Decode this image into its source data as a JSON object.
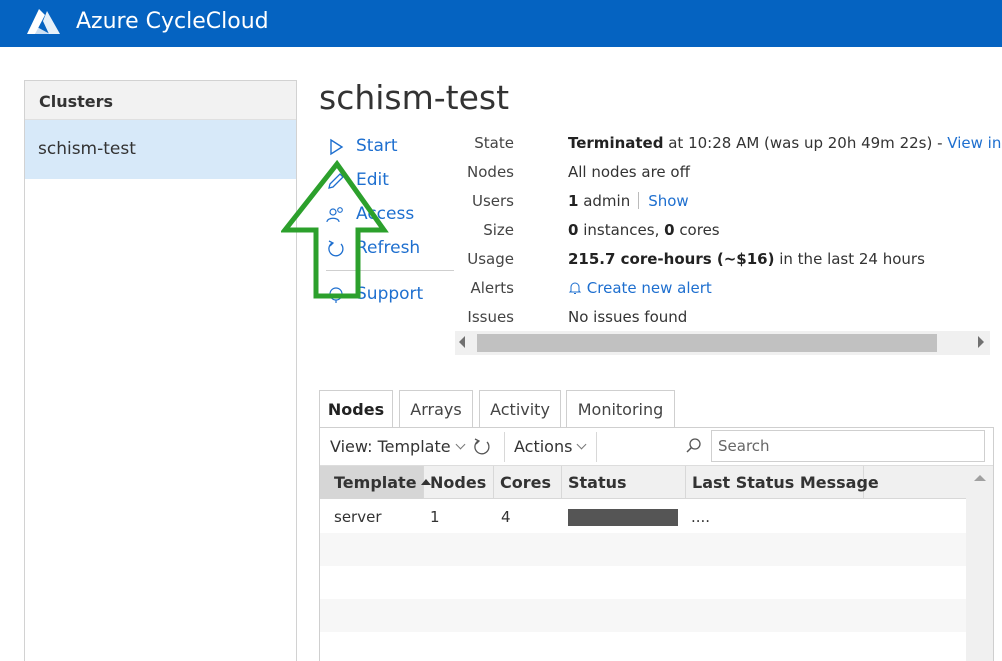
{
  "app": {
    "title": "Azure CycleCloud",
    "brand_color": "#0563c1"
  },
  "sidebar": {
    "header": "Clusters",
    "items": [
      {
        "label": "schism-test",
        "selected": true
      }
    ]
  },
  "cluster": {
    "name": "schism-test"
  },
  "actions": [
    {
      "label": "Start",
      "icon": "play-icon"
    },
    {
      "label": "Edit",
      "icon": "pencil-icon"
    },
    {
      "label": "Access",
      "icon": "users-icon"
    },
    {
      "label": "Refresh",
      "icon": "refresh-icon"
    },
    {
      "label": "Support",
      "icon": "support-icon"
    }
  ],
  "info": {
    "state": {
      "key": "State",
      "value_bold": "Terminated",
      "value_rest": " at 10:28 AM (was up 20h 49m 22s) - ",
      "link": "View in P"
    },
    "nodes": {
      "key": "Nodes",
      "value": "All nodes are off"
    },
    "users": {
      "key": "Users",
      "count": "1",
      "name": " admin",
      "link": "Show"
    },
    "size": {
      "key": "Size",
      "instances": "0",
      "instances_label": " instances, ",
      "cores": "0",
      "cores_label": " cores"
    },
    "usage": {
      "key": "Usage",
      "value_bold": "215.7 core-hours (~$16)",
      "value_rest": " in the last 24 hours"
    },
    "alerts": {
      "key": "Alerts",
      "link": "Create new alert"
    },
    "issues": {
      "key": "Issues",
      "value": "No issues found"
    }
  },
  "tabs": [
    {
      "label": "Nodes",
      "active": true
    },
    {
      "label": "Arrays",
      "active": false
    },
    {
      "label": "Activity",
      "active": false
    },
    {
      "label": "Monitoring",
      "active": false
    }
  ],
  "grid": {
    "view_label": "View: Template",
    "actions_label": "Actions",
    "search_placeholder": "Search",
    "columns": [
      "Template",
      "Nodes",
      "Cores",
      "Status",
      "Last Status Message"
    ],
    "sort_column": "Template",
    "rows": [
      {
        "template": "server",
        "nodes": "1",
        "cores": "4",
        "status": "",
        "message": "...."
      }
    ]
  },
  "annotation": {
    "arrow_color": "#2ca02c"
  }
}
